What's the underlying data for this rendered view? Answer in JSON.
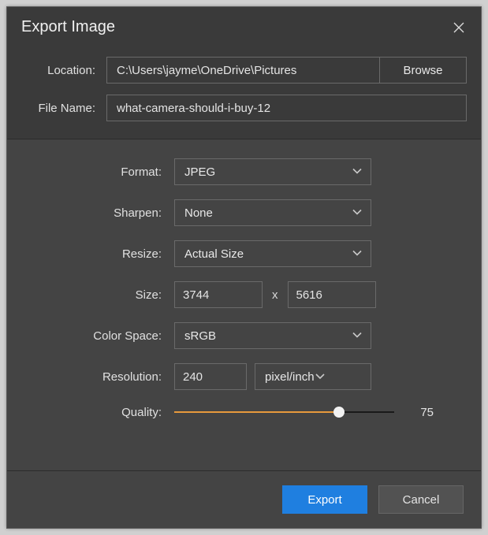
{
  "title": "Export Image",
  "location": {
    "label": "Location:",
    "path": "C:\\Users\\jayme\\OneDrive\\Pictures",
    "browse": "Browse"
  },
  "filename": {
    "label": "File Name:",
    "value": "what-camera-should-i-buy-12"
  },
  "format": {
    "label": "Format:",
    "value": "JPEG"
  },
  "sharpen": {
    "label": "Sharpen:",
    "value": "None"
  },
  "resize": {
    "label": "Resize:",
    "value": "Actual Size"
  },
  "size": {
    "label": "Size:",
    "width": "3744",
    "height": "5616",
    "sep": "x"
  },
  "colorspace": {
    "label": "Color Space:",
    "value": "sRGB"
  },
  "resolution": {
    "label": "Resolution:",
    "value": "240",
    "unit": "pixel/inch"
  },
  "quality": {
    "label": "Quality:",
    "value": "75"
  },
  "buttons": {
    "export": "Export",
    "cancel": "Cancel"
  }
}
